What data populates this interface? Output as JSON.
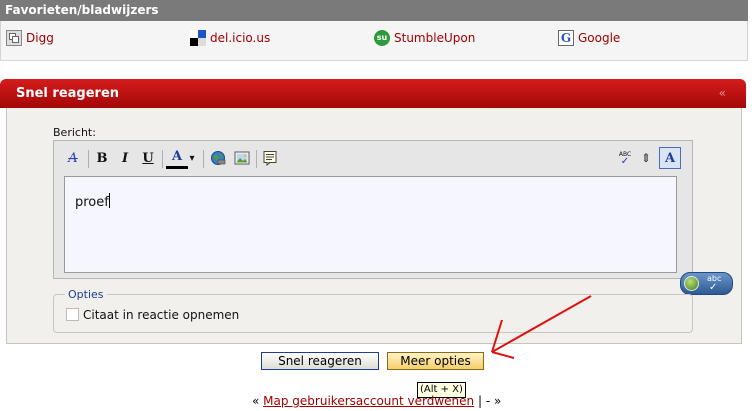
{
  "favorites": {
    "title": "Favorieten/bladwijzers",
    "items": [
      {
        "label": "Digg",
        "icon": "digg-icon"
      },
      {
        "label": "del.icio.us",
        "icon": "delicious-icon"
      },
      {
        "label": "StumbleUpon",
        "icon": "stumbleupon-icon"
      },
      {
        "label": "Google",
        "icon": "google-icon"
      }
    ]
  },
  "panel": {
    "title": "Snel reageren",
    "collapse_glyph": "«",
    "message_label": "Bericht:",
    "message_text": "proef",
    "toolbar": {
      "remove_format_glyph": "A",
      "bold_glyph": "B",
      "italic_glyph": "I",
      "underline_glyph": "U",
      "font_color_glyph": "A",
      "font_color_dropdown_glyph": "▾",
      "spellcheck_glyph": "ABC",
      "resize_glyph": "⇕",
      "mode_glyph": "A"
    },
    "spell_badge": {
      "text": "abc",
      "check_glyph": "✓"
    },
    "options": {
      "legend": "Opties",
      "quote_label": "Citaat in reactie opnemen"
    },
    "buttons": {
      "quick_reply": "Snel reageren",
      "more_options": "Meer opties"
    },
    "tooltip": "(Alt + X)"
  },
  "footer": {
    "prev": "«",
    "link": "Map gebruikersaccount verdwenen",
    "separator": "| -",
    "next": "»"
  },
  "colors": {
    "panel_header": "#c11212",
    "link": "#a00000",
    "arrow": "#e01010"
  }
}
